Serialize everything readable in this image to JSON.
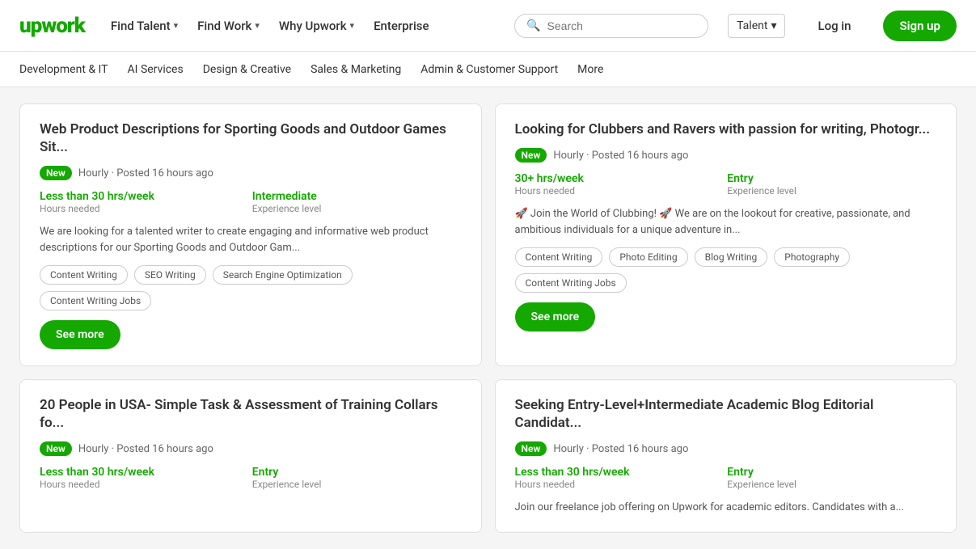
{
  "logo": {
    "text": "upwork"
  },
  "topnav": {
    "find_talent": "Find Talent",
    "find_work": "Find Work",
    "why_upwork": "Why Upwork",
    "enterprise": "Enterprise",
    "search_placeholder": "Search",
    "talent_label": "Talent",
    "login_label": "Log in",
    "signup_label": "Sign up"
  },
  "subnav": {
    "items": [
      {
        "label": "Development & IT"
      },
      {
        "label": "AI Services"
      },
      {
        "label": "Design & Creative"
      },
      {
        "label": "Sales & Marketing"
      },
      {
        "label": "Admin & Customer Support"
      },
      {
        "label": "More"
      }
    ]
  },
  "jobs": [
    {
      "id": "job1",
      "title": "Web Product Descriptions for Sporting Goods and Outdoor Games Sit...",
      "badge": "New",
      "meta": "Hourly · Posted 16 hours ago",
      "stat1_value": "Less than 30 hrs/week",
      "stat1_label": "Hours needed",
      "stat2_value": "Intermediate",
      "stat2_label": "Experience level",
      "description": "We are looking for a talented writer to create engaging and informative web product descriptions for our Sporting Goods and Outdoor Gam...",
      "tags": [
        "Content Writing",
        "SEO Writing",
        "Search Engine Optimization",
        "Content Writing Jobs"
      ],
      "button": "See more"
    },
    {
      "id": "job2",
      "title": "Looking for Clubbers and Ravers with passion for writing, Photogr...",
      "badge": "New",
      "meta": "Hourly · Posted 16 hours ago",
      "stat1_value": "30+ hrs/week",
      "stat1_label": "Hours needed",
      "stat2_value": "Entry",
      "stat2_label": "Experience level",
      "description": "🚀 Join the World of Clubbing! 🚀 We are on the lookout for creative, passionate, and ambitious individuals for a unique adventure in...",
      "tags": [
        "Content Writing",
        "Photo Editing",
        "Blog Writing",
        "Photography",
        "Content Writing Jobs"
      ],
      "button": "See more"
    },
    {
      "id": "job3",
      "title": "20 People in USA- Simple Task & Assessment of Training Collars fo...",
      "badge": "New",
      "meta": "Hourly · Posted 16 hours ago",
      "stat1_value": "Less than 30 hrs/week",
      "stat1_label": "Hours needed",
      "stat2_value": "Entry",
      "stat2_label": "Experience level",
      "description": "",
      "tags": [],
      "button": ""
    },
    {
      "id": "job4",
      "title": "Seeking Entry-Level+Intermediate Academic Blog Editorial Candidat...",
      "badge": "New",
      "meta": "Hourly · Posted 16 hours ago",
      "stat1_value": "Less than 30 hrs/week",
      "stat1_label": "Hours needed",
      "stat2_value": "Entry",
      "stat2_label": "Experience level",
      "description": "Join our freelance job offering on Upwork for academic editors. Candidates with a...",
      "tags": [],
      "button": ""
    }
  ]
}
